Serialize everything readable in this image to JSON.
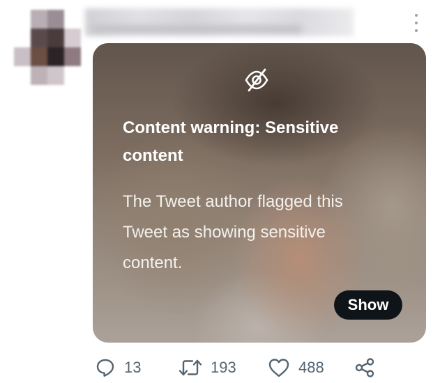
{
  "tweet": {
    "header": {
      "avatar_alt": "",
      "more_icon": "more-vertical-icon"
    },
    "media": {
      "icon": "eye-slash-icon",
      "warning_title": "Content warning: Sensitive content",
      "warning_description": "The Tweet author flagged this Tweet as showing sensitive content.",
      "show_label": "Show"
    },
    "actions": {
      "reply_count": "13",
      "retweet_count": "193",
      "like_count": "488",
      "icons": [
        "reply-icon",
        "retweet-icon",
        "like-icon",
        "share-icon"
      ]
    }
  },
  "colors": {
    "button_bg": "#0f1419",
    "action_gray": "#536471",
    "more_dots": "#9aa3ab"
  }
}
